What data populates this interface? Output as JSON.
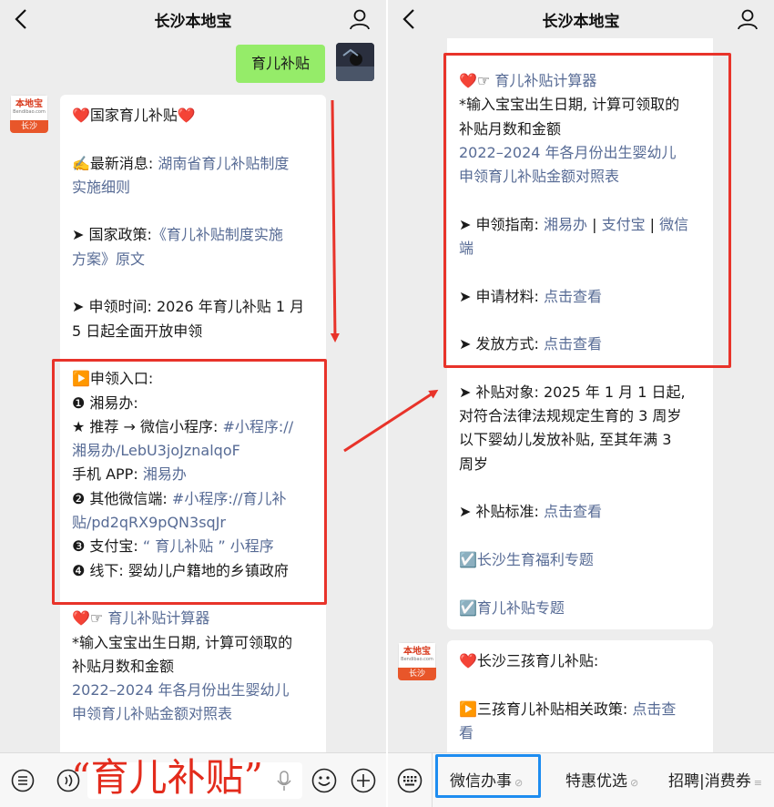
{
  "app": {
    "title": "长沙本地宝",
    "logo_top": "本地宝",
    "logo_sub": "Bendibao.com",
    "logo_bottom": "长沙"
  },
  "left": {
    "user_message": "育儿补贴",
    "bubble1_lines": [
      [
        {
          "t": "❤️国家育儿补贴❤️"
        }
      ],
      [],
      [
        {
          "t": "✍️最新消息: "
        },
        {
          "t": "湖南省育儿补贴制度",
          "l": 1
        }
      ],
      [
        {
          "t": "实施细则",
          "l": 1
        }
      ],
      [],
      [
        {
          "t": "➤ 国家政策:"
        },
        {
          "t": "《育儿补贴制度实施",
          "l": 1
        }
      ],
      [
        {
          "t": "方案》原文",
          "l": 1
        }
      ],
      [],
      [
        {
          "t": "➤ 申领时间: 2026 年育儿补贴 1 月"
        }
      ],
      [
        {
          "t": "5 日起全面开放申领"
        }
      ],
      [],
      [
        {
          "t": "▶️申领入口:"
        }
      ],
      [
        {
          "t": "❶ 湘易办:"
        }
      ],
      [
        {
          "t": "★ 推荐 → 微信小程序: "
        },
        {
          "t": "#小程序://",
          "l": 1
        }
      ],
      [
        {
          "t": "湘易办/LebU3joJznalqoF",
          "l": 1
        }
      ],
      [
        {
          "t": "手机 APP: "
        },
        {
          "t": "湘易办",
          "l": 1
        }
      ],
      [
        {
          "t": "❷ 其他微信端: "
        },
        {
          "t": "#小程序://育儿补",
          "l": 1
        }
      ],
      [
        {
          "t": "贴/pd2qRX9pQN3sqJr",
          "l": 1
        }
      ],
      [
        {
          "t": "❸ 支付宝: "
        },
        {
          "t": "“ 育儿补贴 ” 小程序",
          "l": 1
        }
      ],
      [
        {
          "t": "❹ 线下: 婴幼儿户籍地的乡镇政府"
        }
      ],
      [],
      [
        {
          "t": "❤️☞ "
        },
        {
          "t": "育儿补贴计算器",
          "l": 1
        }
      ],
      [
        {
          "t": "*输入宝宝出生日期, 计算可领取的"
        }
      ],
      [
        {
          "t": "补贴月数和金额"
        }
      ],
      [
        {
          "t": "2022–2024 年各月份出生婴幼儿",
          "l": 1
        }
      ],
      [
        {
          "t": "申领育儿补贴金额对照表",
          "l": 1
        }
      ]
    ],
    "overlay": "“育儿补贴”"
  },
  "right": {
    "bubble1_lines": [
      [
        {
          "t": "❤️☞ "
        },
        {
          "t": "育儿补贴计算器",
          "l": 1
        }
      ],
      [
        {
          "t": "*输入宝宝出生日期, 计算可领取的"
        }
      ],
      [
        {
          "t": "补贴月数和金额"
        }
      ],
      [
        {
          "t": "2022–2024 年各月份出生婴幼儿",
          "l": 1
        }
      ],
      [
        {
          "t": "申领育儿补贴金额对照表",
          "l": 1
        }
      ],
      [],
      [
        {
          "t": "➤ 申领指南: "
        },
        {
          "t": "湘易办",
          "l": 1
        },
        {
          "t": " | "
        },
        {
          "t": "支付宝",
          "l": 1
        },
        {
          "t": " | "
        },
        {
          "t": "微信",
          "l": 1
        }
      ],
      [
        {
          "t": "端",
          "l": 1
        }
      ],
      [],
      [
        {
          "t": "➤ 申请材料: "
        },
        {
          "t": "点击查看",
          "l": 1
        }
      ],
      [],
      [
        {
          "t": "➤ 发放方式: "
        },
        {
          "t": "点击查看",
          "l": 1
        }
      ],
      [],
      [
        {
          "t": "➤ 补贴对象: 2025 年 1 月 1 日起,"
        }
      ],
      [
        {
          "t": "对符合法律法规规定生育的 3 周岁"
        }
      ],
      [
        {
          "t": "以下婴幼儿发放补贴, 至其年满 3"
        }
      ],
      [
        {
          "t": "周岁"
        }
      ],
      [],
      [
        {
          "t": "➤ 补贴标准: "
        },
        {
          "t": "点击查看",
          "l": 1
        }
      ],
      [],
      [
        {
          "t": "☑️"
        },
        {
          "t": "长沙生育福利专题",
          "l": 1
        }
      ],
      [],
      [
        {
          "t": "☑️"
        },
        {
          "t": "育儿补贴专题",
          "l": 1
        }
      ]
    ],
    "bubble2_lines": [
      [
        {
          "t": "❤️长沙三孩育儿补贴:"
        }
      ],
      [],
      [
        {
          "t": "▶️三孩育儿补贴相关政策: "
        },
        {
          "t": "点击查",
          "l": 1
        }
      ],
      [
        {
          "t": "看",
          "l": 1
        }
      ]
    ],
    "menu": [
      "微信办事",
      "特惠优选",
      "招聘|消费券"
    ]
  },
  "colors": {
    "link": "#576b95",
    "annotation_red": "#e8332a",
    "annotation_blue": "#1e8df0",
    "user_bubble": "#95ec69"
  },
  "icons": [
    "back-icon",
    "user-icon",
    "keyboard-icon",
    "voice-icon",
    "mic-icon",
    "emoji-icon",
    "plus-icon",
    "link-icon",
    "menu-lines-icon"
  ]
}
